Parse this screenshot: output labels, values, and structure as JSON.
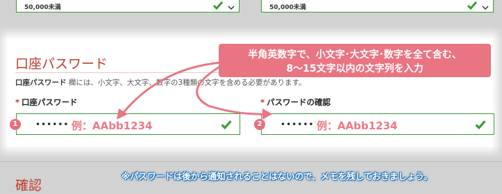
{
  "top_selects": [
    {
      "value": "50,000未満"
    },
    {
      "value": "50,000未満"
    }
  ],
  "section": {
    "title": "口座パスワード",
    "description_bold": "口座パスワード",
    "description_rest": "欄には、小文字、大文字、数字の3種類の文字を含める必要があります。"
  },
  "fields": [
    {
      "required_mark": "*",
      "label": "口座パスワード",
      "value": "••••••",
      "number": "1",
      "example": "例：AAbb1234"
    },
    {
      "required_mark": "*",
      "label": "パスワードの確認",
      "value": "••••••",
      "number": "2",
      "example": "例：AAbb1234"
    }
  ],
  "callout": {
    "line1": "半角英数字で、小文字･大文字･数字を全て含む、",
    "line2": "8～15文字以内の文字列を入力"
  },
  "next_section": {
    "title": "確認"
  },
  "note": "※パスワードは後から通知されることはないので、メモを残しておきましょう。",
  "colors": {
    "accent": "#ea7582",
    "valid": "#3a9a3a",
    "heading": "#c0392b",
    "note": "#1f6fb5"
  }
}
